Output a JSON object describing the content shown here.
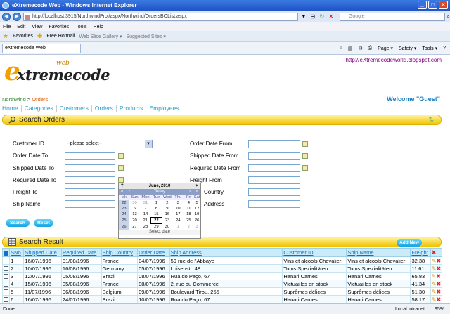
{
  "window": {
    "title": "eXtremecode Web - Windows Internet Explorer"
  },
  "browser": {
    "url": "http://localhost:3915/NorthwindProj/aspx/Northwind/OrdersBOList.aspx",
    "search_placeholder": "Google",
    "menu": [
      "File",
      "Edit",
      "View",
      "Favorites",
      "Tools",
      "Help"
    ],
    "favorites_label": "Favorites",
    "fav_links": [
      "Free Hotmail",
      "Web Slice Gallery ▾",
      "Suggested Sites ▾"
    ],
    "tab_title": "eXtremecode Web",
    "commands": [
      "Page ▾",
      "Safety ▾",
      "Tools ▾",
      "?"
    ]
  },
  "site": {
    "logo_main": "xtremecode",
    "logo_letter": "e",
    "logo_web": "web",
    "blog_link": "http://eXtremecodeworld.blogspot.com",
    "breadcrumb_root": "Northwind",
    "breadcrumb_sep": ">",
    "breadcrumb_current": "Orders",
    "welcome": "Welcome \"Guest\"",
    "nav": [
      "Home",
      "Categories",
      "Customers",
      "Orders",
      "Products",
      "Employees"
    ]
  },
  "search_panel": {
    "title": "Search Orders",
    "customer_id_label": "Customer ID",
    "customer_id_value": "--please select--",
    "order_date_to_label": "Order Date To",
    "shipped_date_to_label": "Shipped Date To",
    "required_date_to_label": "Required Date To",
    "freight_to_label": "Freight To",
    "ship_name_label": "Ship Name",
    "order_date_from_label": "Order Date From",
    "shipped_date_from_label": "Shipped Date From",
    "required_date_from_label": "Required Date From",
    "freight_from_label": "Freight From",
    "ship_country_label": "Country",
    "ship_address_label": "Address",
    "search_button": "Search",
    "reset_button": "Reset"
  },
  "calendar": {
    "prev": "‹",
    "prev_year": "«",
    "next": "›",
    "next_year": "»",
    "close": "×",
    "help": "?",
    "month_title": "June, 2010",
    "today_label": "Today",
    "week_label": "wk",
    "days": [
      "Sun",
      "Mon",
      "Tue",
      "Wed",
      "Thu",
      "Fri",
      "Sat"
    ],
    "weeks": [
      {
        "wk": "22",
        "d": [
          "30",
          "31",
          "1",
          "2",
          "3",
          "4",
          "5"
        ]
      },
      {
        "wk": "23",
        "d": [
          "6",
          "7",
          "8",
          "9",
          "10",
          "11",
          "12"
        ]
      },
      {
        "wk": "24",
        "d": [
          "13",
          "14",
          "15",
          "16",
          "17",
          "18",
          "19"
        ]
      },
      {
        "wk": "25",
        "d": [
          "20",
          "21",
          "22",
          "23",
          "24",
          "25",
          "26"
        ]
      },
      {
        "wk": "26",
        "d": [
          "27",
          "28",
          "29",
          "30",
          "1",
          "2",
          "3"
        ]
      }
    ],
    "selected_day": "22",
    "footer": "Select date"
  },
  "results": {
    "title": "Search Result",
    "add_new": "Add New",
    "columns": [
      "SNo",
      "Shipped Date",
      "Required Date",
      "Ship Country",
      "Order Date",
      "Ship Address",
      "Customer ID",
      "Ship Name",
      "Freight"
    ],
    "rows": [
      [
        "1",
        "16/07/1996",
        "01/08/1996",
        "France",
        "04/07/1996",
        "59 rue de l'Abbaye",
        "Vins et alcools Chevalier",
        "Vins et alcools Chevalier",
        "32.38"
      ],
      [
        "2",
        "10/07/1996",
        "16/08/1996",
        "Germany",
        "05/07/1996",
        "Luisenstr. 48",
        "Toms Spezialitäten",
        "Toms Spezialitäten",
        "11.61"
      ],
      [
        "3",
        "12/07/1996",
        "05/08/1996",
        "Brazil",
        "08/07/1996",
        "Rua do Paço, 67",
        "Hanari Carnes",
        "Hanari Carnes",
        "65.83"
      ],
      [
        "4",
        "15/07/1996",
        "05/08/1996",
        "France",
        "08/07/1996",
        "2, rue du Commerce",
        "Victuailles en stock",
        "Victuailles en stock",
        "41.34"
      ],
      [
        "5",
        "11/07/1996",
        "06/08/1996",
        "Belgium",
        "09/07/1996",
        "Boulevard Tirou, 255",
        "Suprêmes délices",
        "Suprêmes délices",
        "51.30"
      ],
      [
        "6",
        "16/07/1996",
        "24/07/1996",
        "Brazil",
        "10/07/1996",
        "Rua do Paço, 67",
        "Hanari Carnes",
        "Hanari Carnes",
        "58.17"
      ]
    ]
  },
  "statusbar": {
    "left": "Done",
    "zone": "Local intranet",
    "zoom": "95%"
  }
}
